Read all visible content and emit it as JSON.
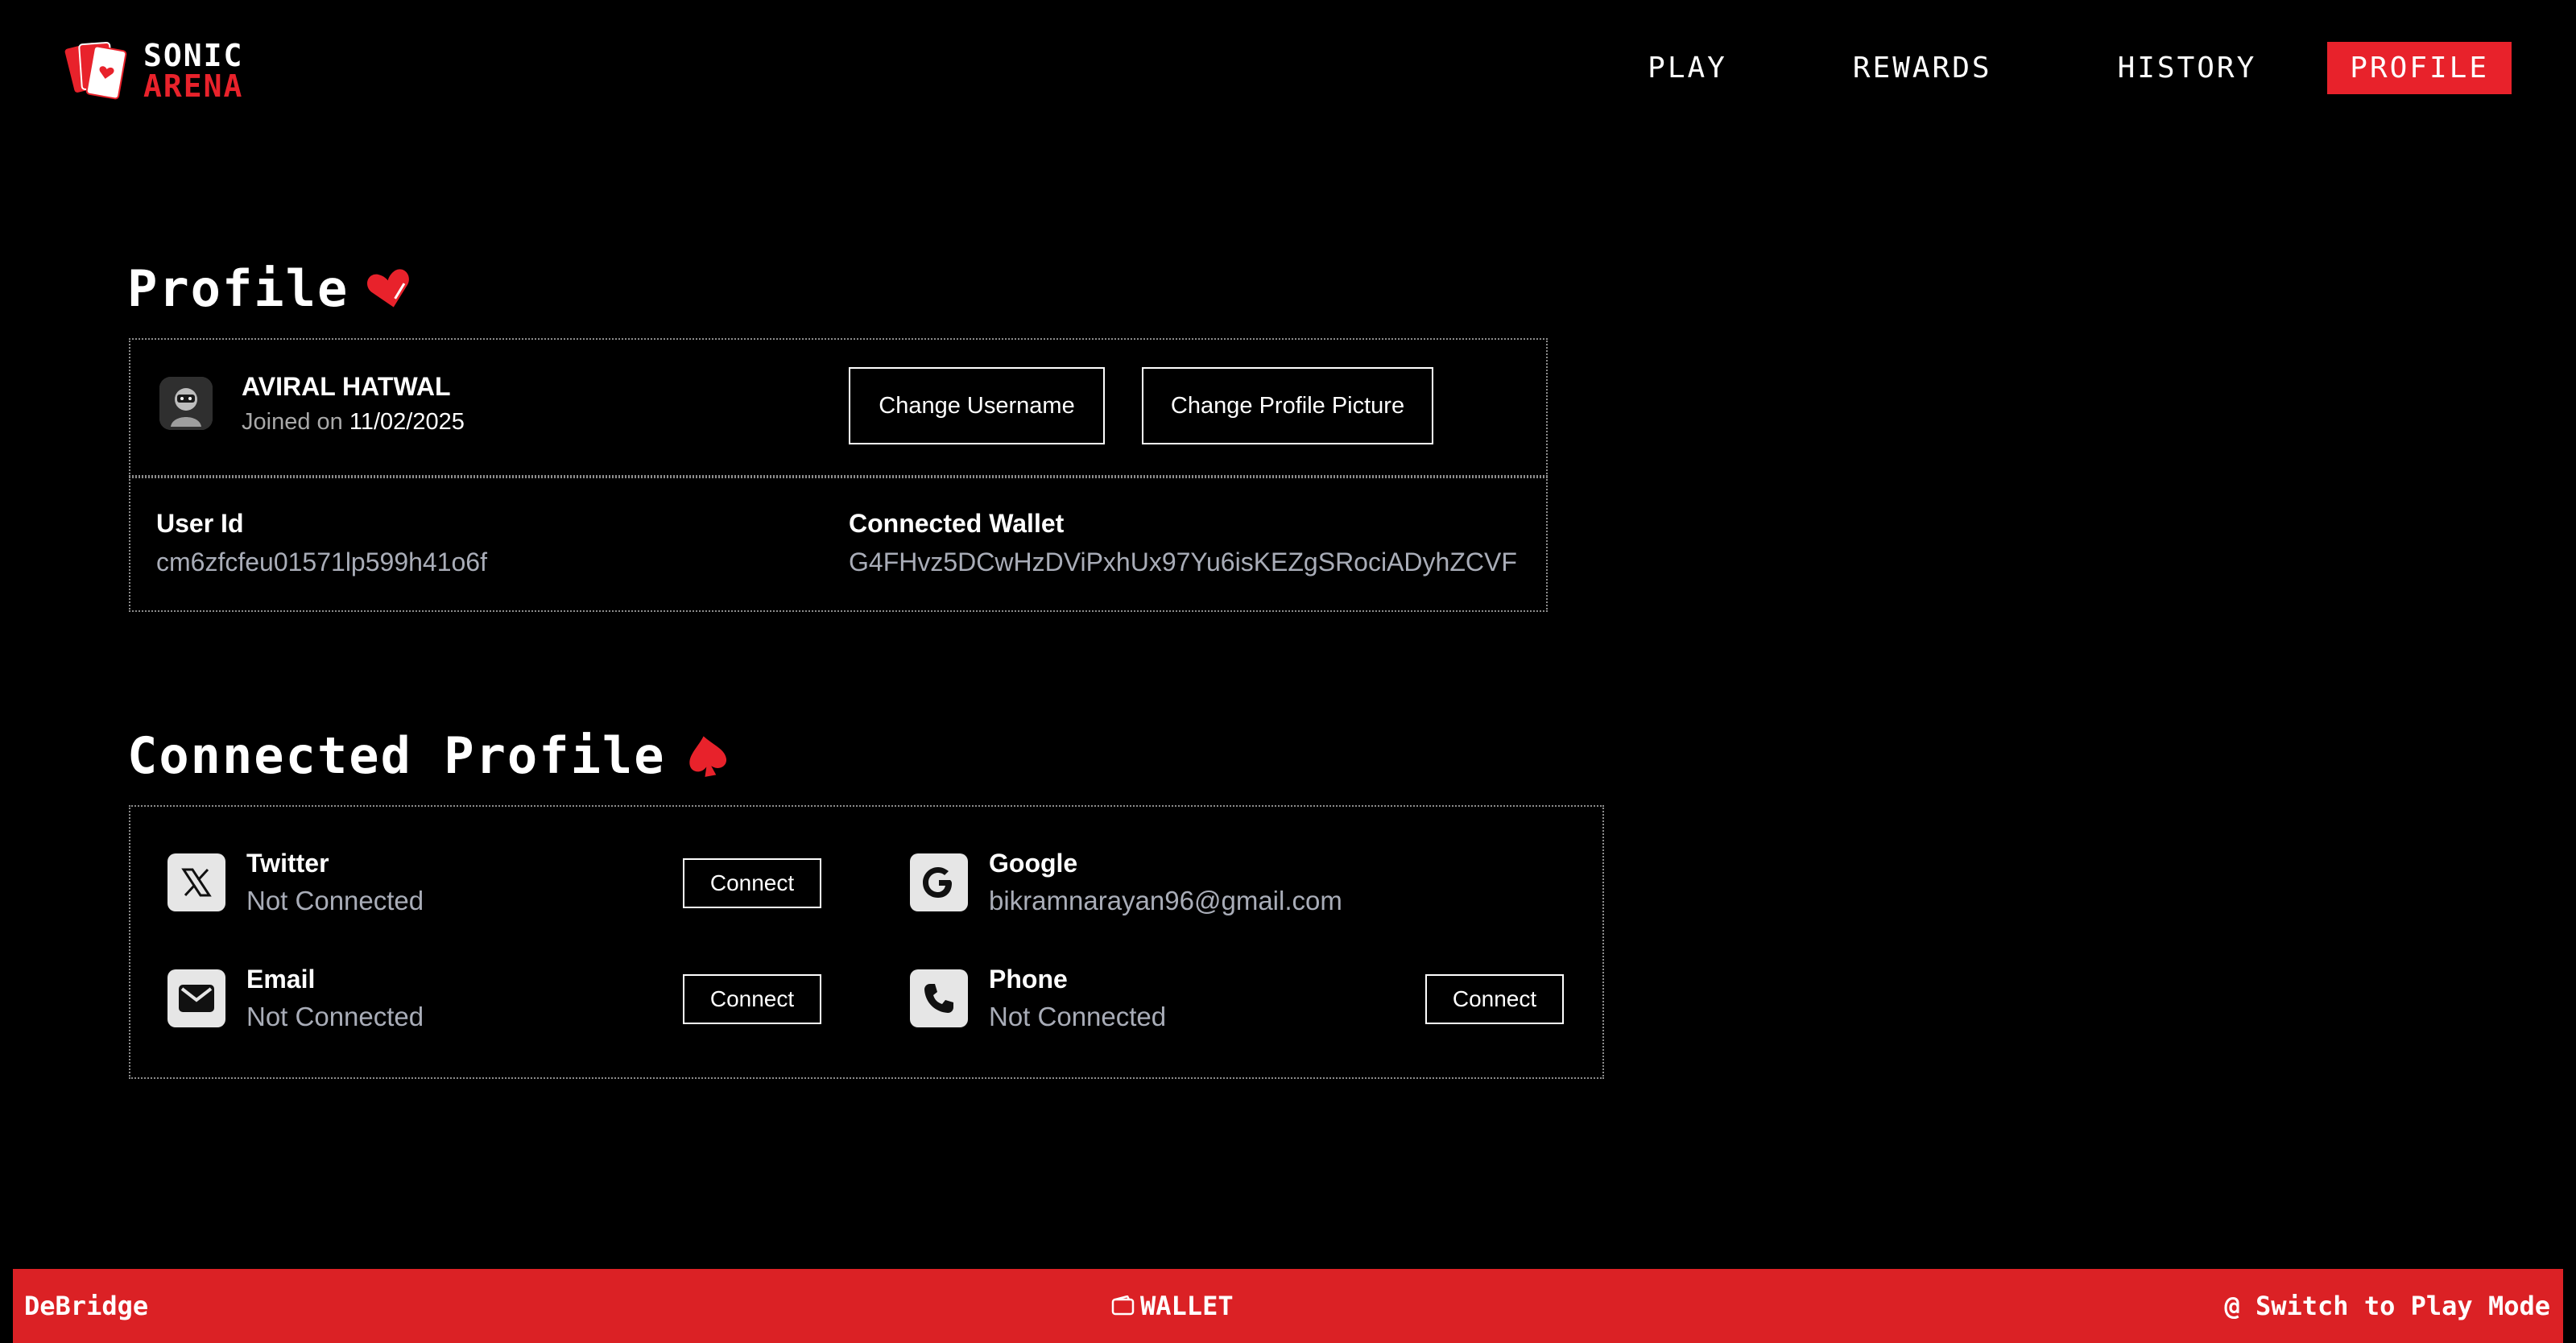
{
  "app": {
    "logo_line1": "SONIC",
    "logo_line2": "ARENA"
  },
  "nav": {
    "items": [
      {
        "label": "PLAY"
      },
      {
        "label": "REWARDS"
      },
      {
        "label": "HISTORY"
      },
      {
        "label": "PROFILE",
        "active": true
      }
    ]
  },
  "profile": {
    "title": "Profile",
    "title_icon": "heart-icon",
    "user_name": "AVIRAL HATWAL",
    "joined_prefix": "Joined on",
    "joined_date": "11/02/2025",
    "change_username_label": "Change Username",
    "change_picture_label": "Change Profile Picture",
    "user_id_label": "User Id",
    "user_id_value": "cm6zfcfeu01571lp599h41o6f",
    "wallet_label": "Connected Wallet",
    "wallet_value": "G4FHvz5DCwHzDViPxhUx97Yu6isKEZgSRociADyhZCVF"
  },
  "connected": {
    "title": "Connected Profile",
    "title_icon": "spade-icon",
    "twitter": {
      "name": "Twitter",
      "status": "Not Connected",
      "button": "Connect",
      "icon": "x-icon"
    },
    "google": {
      "name": "Google",
      "status": "bikramnarayan96@gmail.com",
      "icon": "google-icon"
    },
    "email": {
      "name": "Email",
      "status": "Not Connected",
      "button": "Connect",
      "icon": "mail-icon"
    },
    "phone": {
      "name": "Phone",
      "status": "Not Connected",
      "button": "Connect",
      "icon": "phone-icon"
    }
  },
  "footer": {
    "left": "DeBridge",
    "mid": "WALLET",
    "right": "@ Switch to Play Mode"
  },
  "colors": {
    "accent": "#e8222b",
    "background": "#000000",
    "muted_text": "#a9adb8"
  }
}
